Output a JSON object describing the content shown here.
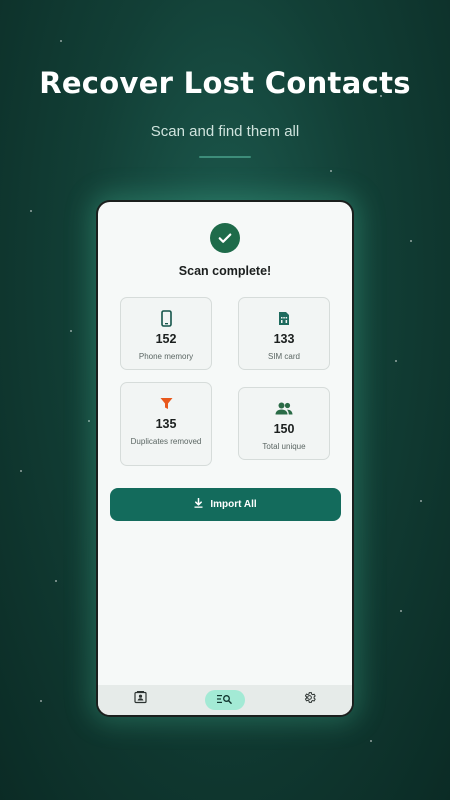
{
  "promo": {
    "headline": "Recover Lost Contacts",
    "subheadline": "Scan and find them all"
  },
  "scan": {
    "status": "Scan complete!",
    "stats": [
      {
        "value": "152",
        "label": "Phone memory",
        "icon": "phone-icon"
      },
      {
        "value": "133",
        "label": "SIM card",
        "icon": "sim-card-icon"
      },
      {
        "value": "135",
        "label": "Duplicates removed",
        "icon": "filter-icon"
      },
      {
        "value": "150",
        "label": "Total unique",
        "icon": "people-icon"
      }
    ],
    "import_label": "Import All"
  },
  "nav": {
    "items": [
      {
        "icon": "contacts-icon",
        "active": false
      },
      {
        "icon": "scan-search-icon",
        "active": true
      },
      {
        "icon": "settings-icon",
        "active": false
      }
    ]
  },
  "colors": {
    "primary": "#136b5c",
    "success": "#1e6b4a",
    "filter_accent": "#e8581c",
    "nav_active": "#a3ead5",
    "background": "#123f36"
  }
}
